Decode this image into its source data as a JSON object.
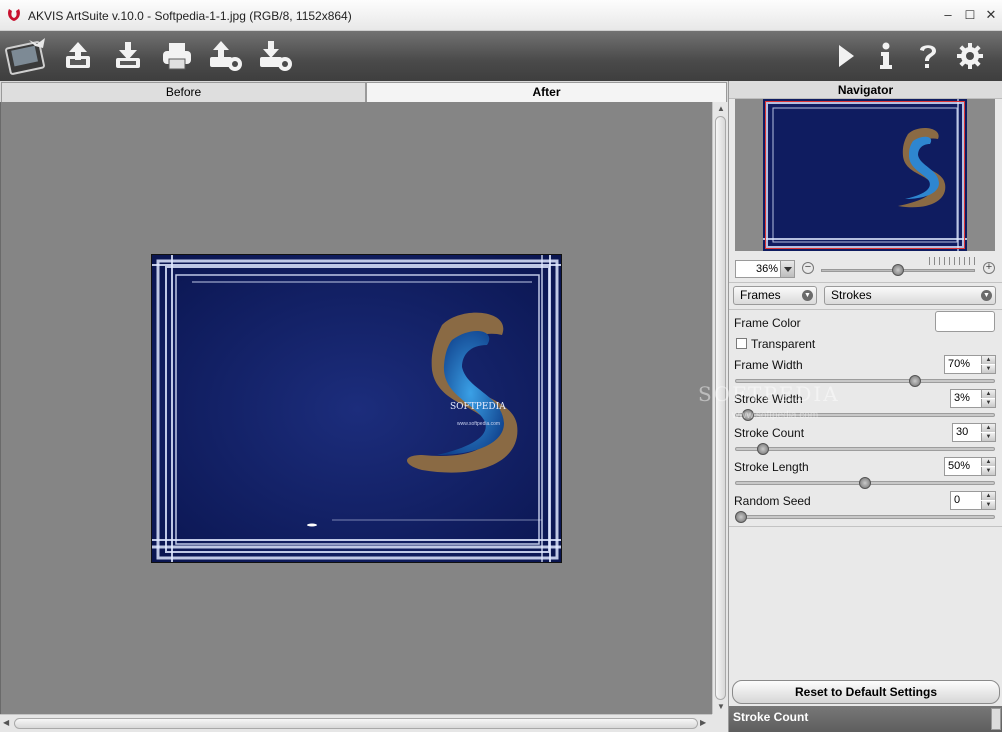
{
  "window": {
    "title": "AKVIS ArtSuite v.10.0 - Softpedia-1-1.jpg (RGB/8, 1152x864)",
    "buttons": {
      "minimize": "–",
      "maximize": "☐",
      "close": "✕"
    }
  },
  "toolbar": {
    "left": [
      "artsuite-logo",
      "open-icon",
      "save-icon",
      "print-icon",
      "share-icon",
      "batch-icon"
    ],
    "right": [
      "run-icon",
      "info-icon",
      "help-icon",
      "settings-icon"
    ]
  },
  "tabs": {
    "before": "Before",
    "after": "After",
    "active": "After"
  },
  "artwork": {
    "brand": "SOFTPEDIA",
    "url": "www.softpedia.com"
  },
  "watermark": {
    "brand": "SOFTPEDIA",
    "sub": "www.softpedia.com"
  },
  "navigator": {
    "title": "Navigator",
    "zoom": "36%",
    "zoom_level": 0.5
  },
  "effect": {
    "category": "Frames",
    "type": "Strokes"
  },
  "params": {
    "frame_color_label": "Frame Color",
    "frame_color": "#ffffff",
    "transparent_label": "Transparent",
    "transparent_checked": false,
    "frame_width": {
      "label": "Frame Width",
      "value": "70%",
      "level": 0.7
    },
    "stroke_width": {
      "label": "Stroke Width",
      "value": "3%",
      "level": 0.03
    },
    "stroke_count": {
      "label": "Stroke Count",
      "value": "30",
      "level": 0.09
    },
    "stroke_length": {
      "label": "Stroke Length",
      "value": "50%",
      "level": 0.5
    },
    "random_seed": {
      "label": "Random Seed",
      "value": "0",
      "level": 0.0
    }
  },
  "reset_label": "Reset to Default Settings",
  "hint": "Stroke Count",
  "colors": {
    "toolbar": "#4a4a4a",
    "canvas": "#858585",
    "art_bg": "#0d1b5e",
    "accent_red": "#cc2222"
  }
}
